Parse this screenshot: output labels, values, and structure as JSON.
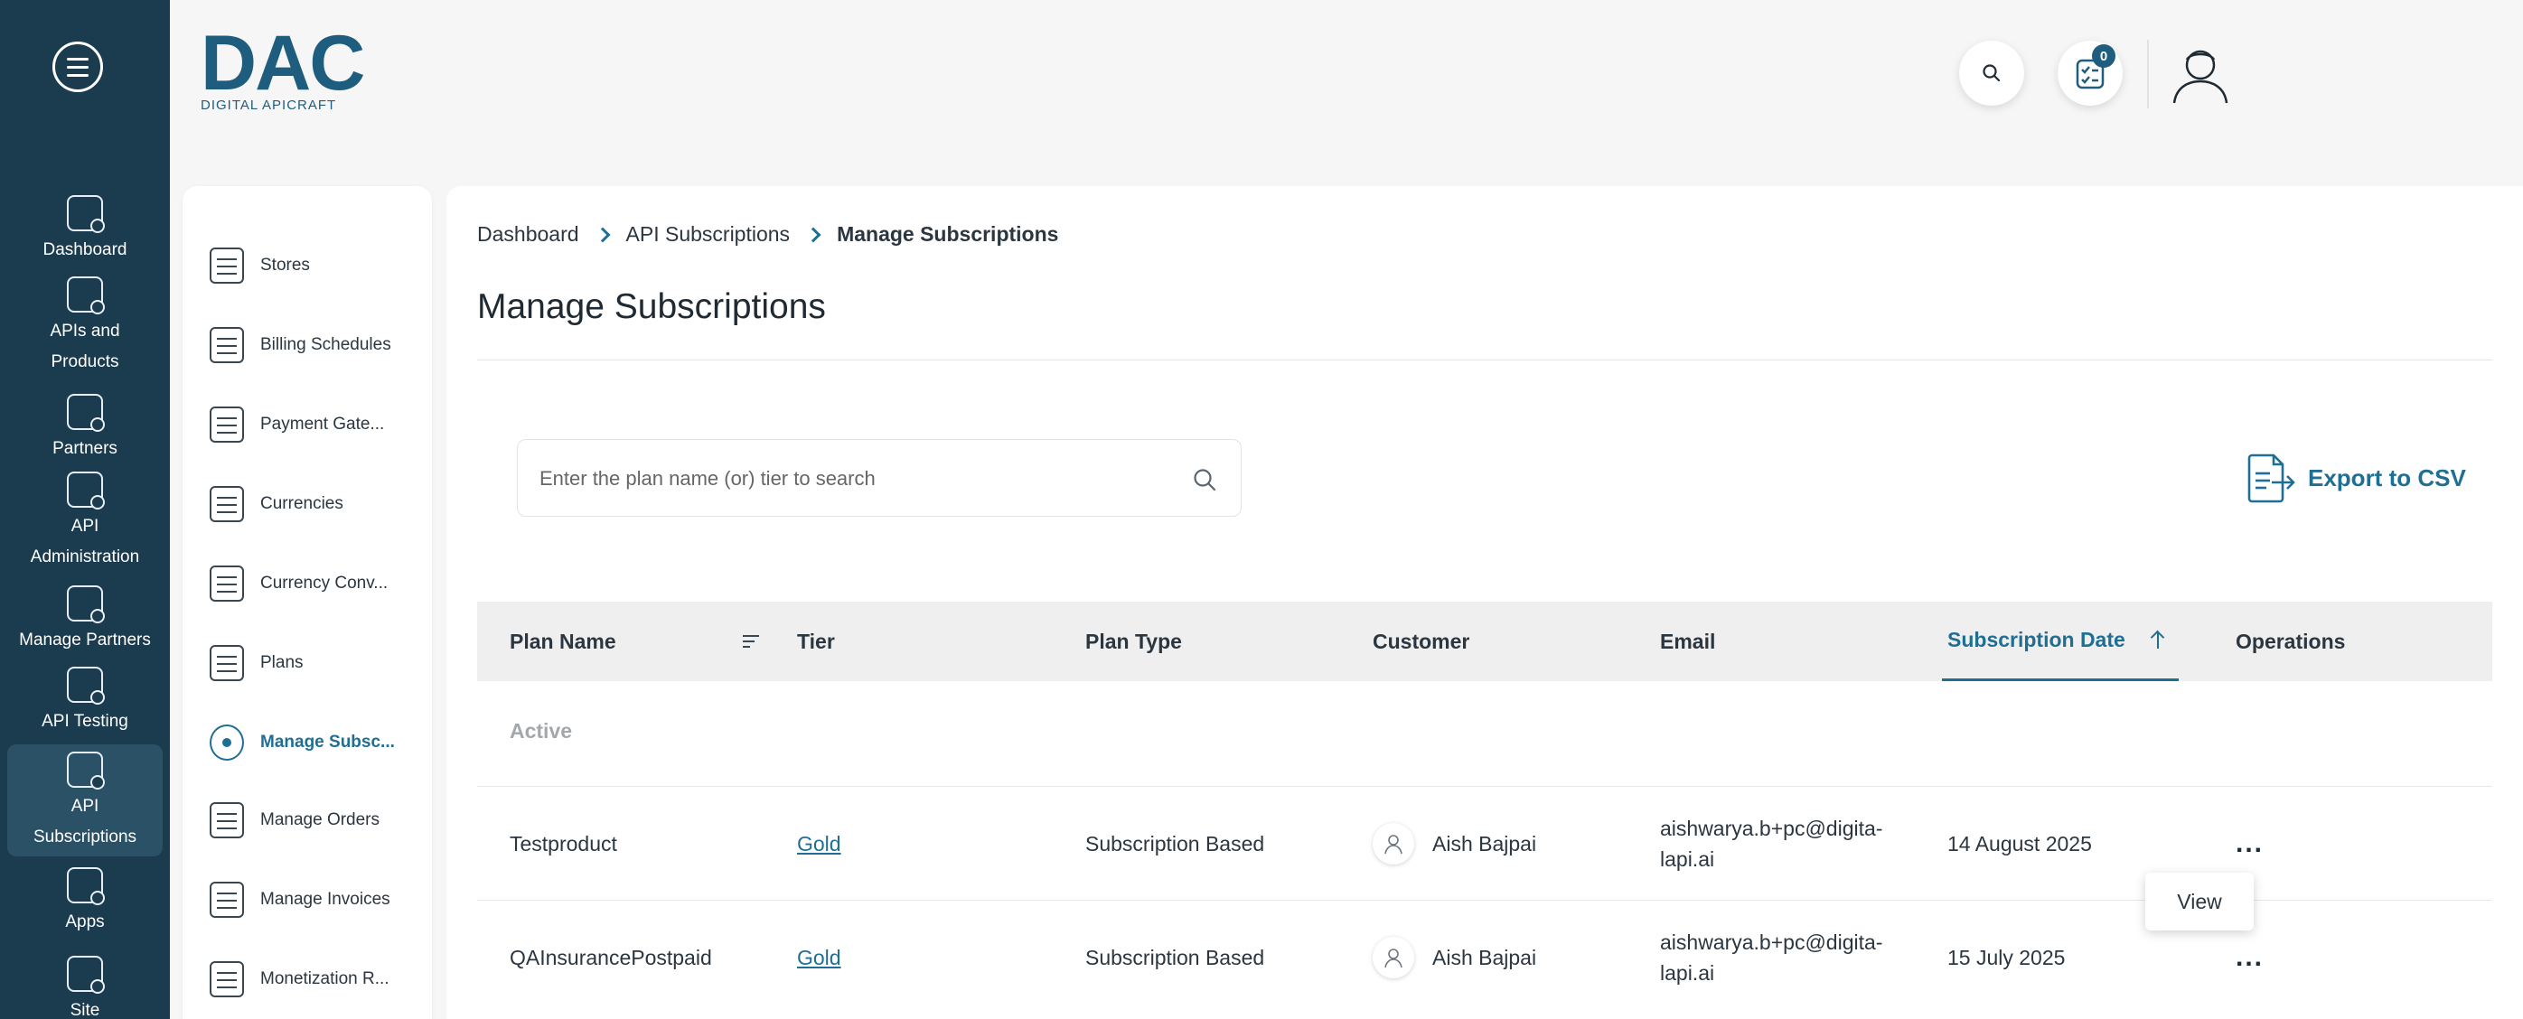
{
  "rail": {
    "items": [
      {
        "label": "Dashboard",
        "icon": "dashboard-icon"
      },
      {
        "label": "APIs and Products",
        "icon": "apis-products-icon"
      },
      {
        "label": "Partners",
        "icon": "handshake-icon"
      },
      {
        "label": "API Administration",
        "icon": "api-admin-icon"
      },
      {
        "label": "Manage Partners",
        "icon": "manage-partners-icon"
      },
      {
        "label": "API Testing",
        "icon": "api-testing-icon"
      },
      {
        "label": "API Subscriptions",
        "icon": "api-subscriptions-icon"
      },
      {
        "label": "Apps",
        "icon": "apps-icon"
      },
      {
        "label": "Site",
        "icon": "site-icon"
      }
    ],
    "active_index": 6
  },
  "logo": {
    "mark": "DAC",
    "subtitle": "DIGITAL APICRAFT"
  },
  "header": {
    "tasks_badge": "0"
  },
  "subnav": {
    "items": [
      {
        "label": "Stores"
      },
      {
        "label": "Billing Schedules"
      },
      {
        "label": "Payment Gate..."
      },
      {
        "label": "Currencies"
      },
      {
        "label": "Currency Conv..."
      },
      {
        "label": "Plans"
      },
      {
        "label": "Manage Subsc..."
      },
      {
        "label": "Manage Orders"
      },
      {
        "label": "Manage Invoices"
      },
      {
        "label": "Monetization R..."
      }
    ],
    "active_index": 6
  },
  "breadcrumb": {
    "items": [
      "Dashboard",
      "API Subscriptions",
      "Manage Subscriptions"
    ]
  },
  "page": {
    "title": "Manage Subscriptions"
  },
  "search": {
    "placeholder": "Enter the plan name (or) tier to search",
    "value": ""
  },
  "export": {
    "label": "Export to CSV"
  },
  "table": {
    "columns": [
      "Plan Name",
      "Tier",
      "Plan Type",
      "Customer",
      "Email",
      "Subscription Date",
      "Operations"
    ],
    "sorted_column": "Subscription Date",
    "sort_direction": "ascending",
    "group_label": "Active",
    "rows": [
      {
        "plan_name": "Testproduct",
        "tier": "Gold",
        "plan_type": "Subscription Based",
        "customer": "Aish Bajpai",
        "email": "aishwarya.b+pc@digita-lapi.ai",
        "email_line1": "aishwarya.b+pc@digita-",
        "email_line2": "lapi.ai",
        "date": "14 August 2025",
        "operations": "..."
      },
      {
        "plan_name": "QAInsurancePostpaid",
        "tier": "Gold",
        "plan_type": "Subscription Based",
        "customer": "Aish Bajpai",
        "email": "aishwarya.b+pc@digita-lapi.ai",
        "email_line1": "aishwarya.b+pc@digita-",
        "email_line2": "lapi.ai",
        "date": "15 July 2025",
        "operations": "..."
      }
    ]
  },
  "popover": {
    "label": "View"
  },
  "colors": {
    "rail_bg": "#1b3b4f",
    "accent": "#1f6f94",
    "brand": "#1f5d7e",
    "header_row_bg": "#efefef"
  }
}
